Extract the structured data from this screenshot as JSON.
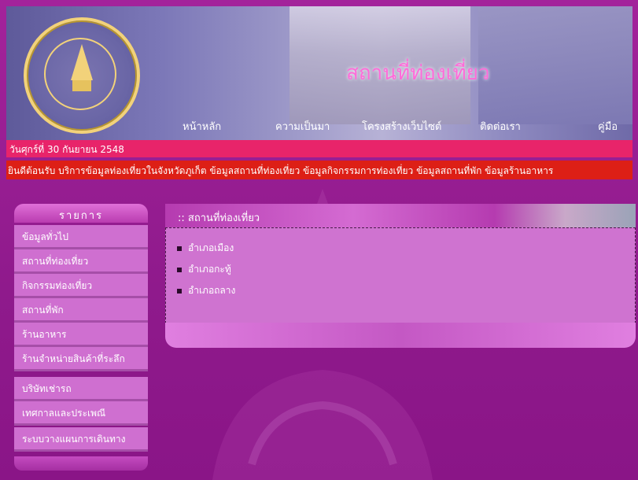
{
  "header": {
    "site_title": "สถานที่ท่องเที่ยว",
    "nav": [
      "หน้าหลัก",
      "ความเป็นมา",
      "โครงสร้างเว็บไซต์",
      "ติดต่อเรา",
      "คู่มือ"
    ]
  },
  "date_text": "วันศุกร์ที่ 30 กันยายน 2548",
  "marquee_text": "ยินดีต้อนรับ บริการข้อมูลท่องเที่ยวในจังหวัดภูเก็ต ข้อมูลสถานที่ท่องเที่ยว ข้อมูลกิจกรรมการท่องเที่ยว ข้อมูลสถานที่พัก ข้อมูลร้านอาหาร",
  "sidebar": {
    "title": "รายการ",
    "items": [
      "ข้อมูลทั่วไป",
      "สถานที่ท่องเที่ยว",
      "กิจกรรมท่องเที่ยว",
      "สถานที่พัก",
      "ร้านอาหาร",
      "ร้านจำหน่ายสินค้าที่ระลึก",
      "บริษัทเช่ารถ",
      "เทศกาลและประเพณี",
      "ระบบวางแผนการเดินทาง"
    ]
  },
  "content": {
    "title": ":: สถานที่ท่องเที่ยว",
    "items": [
      "อำเภอเมือง",
      "อำเภอกะทู้",
      "อำเภอถลาง"
    ]
  },
  "colors": {
    "page_bg": "#9a1a92",
    "date_bar": "#e8246a",
    "marquee_bar": "#dd1f16",
    "menu_item": "#cf6fd0",
    "title_pink": "#ff6bd9"
  }
}
